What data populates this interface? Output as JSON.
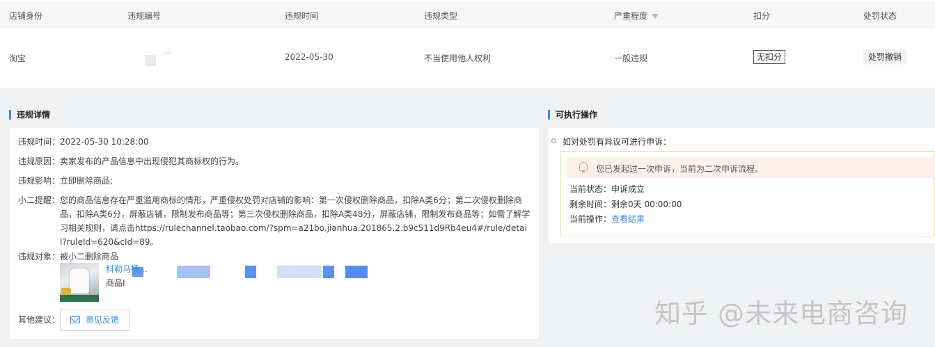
{
  "table": {
    "headers": [
      "店铺身份",
      "违规编号",
      "违规时间",
      "违规类型",
      "严重程度",
      "扣分",
      "处罚状态"
    ],
    "row": {
      "shop": "淘宝",
      "id": "",
      "time": "2022-05-30",
      "type": "不当使用他人权利",
      "severity": "一般违规",
      "points": "无扣分",
      "status": "处罚撤销"
    }
  },
  "detail": {
    "title": "违规详情",
    "time_label": "违规时间：",
    "time_value": "2022-05-30 10:28:00",
    "reason_label": "违规原因：",
    "reason_value": "卖家发布的产品信息中出现侵犯其商标权的行为。",
    "impact_label": "违规影响：",
    "impact_value": "立即删除商品;",
    "hint_label": "小二提醒：",
    "hint_value": "您的商品信息存在严重滥用商标的情形，严重侵权处罚对店铺的影响：第一次侵权删除商品，扣除A类6分；第二次侵权删除商品，扣除A类6分，屏蔽店铺，限制发布商品等；第三次侵权删除商品，扣除A类48分，屏蔽店铺，限制发布商品等；如需了解学习相关规则，请点击https://rulechannel.taobao.com/?spm=a21bo.jianhua.201865.2.b9c511d9Rb4eu4#/rule/detail?ruleId=620&cId=89。",
    "object_label": "违规对象：",
    "object_value": "被小二删除商品",
    "product_title": "科勒马桶…",
    "product_sub": "商品I",
    "suggest_label": "其他建议：",
    "feedback_button": "意见反馈"
  },
  "actions": {
    "title": "可执行操作",
    "question": "如对处罚有异议可进行申诉：",
    "alert": "您已发起过一次申诉，当前为二次申诉流程。",
    "status_label": "当前状态：",
    "status_value": "申诉成立",
    "remain_label": "剩余时间：",
    "remain_value": "剩余0天 00:00:00",
    "op_label": "当前操作：",
    "op_link": "查看结果"
  },
  "watermark": "知乎 @未来电商咨询"
}
